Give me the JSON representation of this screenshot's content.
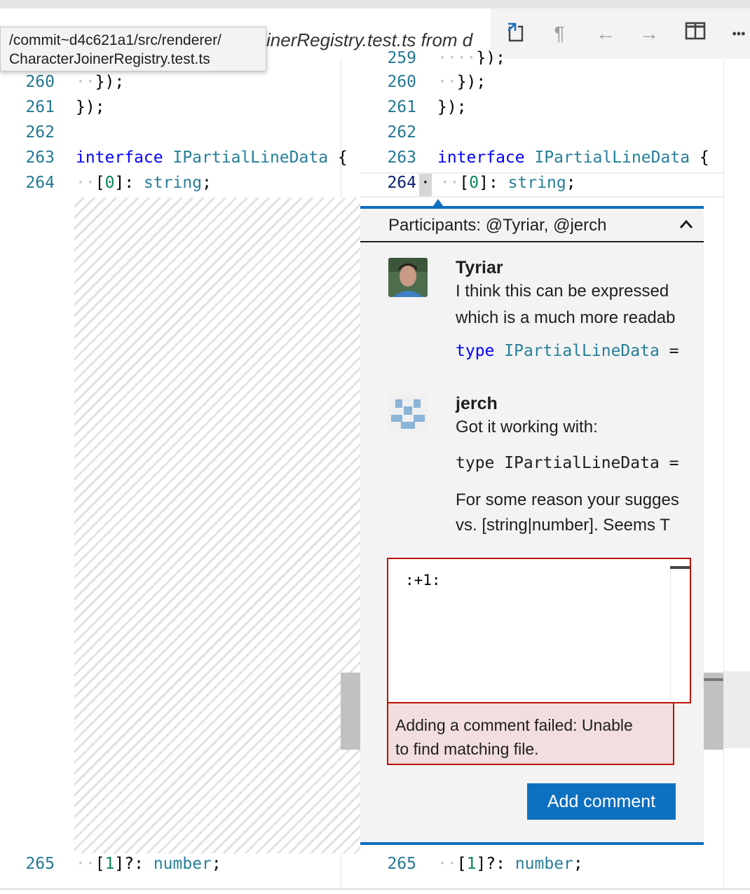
{
  "tab": {
    "title": "inerRegistry.test.ts from d",
    "actions": [
      {
        "name": "open-file-icon",
        "glyph": "⎘"
      },
      {
        "name": "whitespace-icon",
        "glyph": "¶"
      },
      {
        "name": "previous-change-icon",
        "glyph": "←"
      },
      {
        "name": "next-change-icon",
        "glyph": "→"
      },
      {
        "name": "split-editor-icon",
        "glyph": "◫"
      },
      {
        "name": "more-actions-icon",
        "glyph": "•••"
      }
    ]
  },
  "tooltip": {
    "line1": "/commit~d4c621a1/src/renderer/",
    "line2": "CharacterJoinerRegistry.test.ts"
  },
  "left_editor": {
    "lines": [
      {
        "num": "260",
        "text": "});"
      },
      {
        "num": "261",
        "text": "});"
      },
      {
        "num": "262",
        "text": ""
      },
      {
        "num": "263",
        "keyword": "interface",
        "type": "IPartialLineData",
        "rest": " {"
      },
      {
        "num": "264",
        "index": "0",
        "type": "string"
      },
      {
        "num": "265",
        "index": "1",
        "type": "number"
      }
    ]
  },
  "right_editor": {
    "partial_line": "259",
    "lines": [
      {
        "num": "260",
        "text": "});"
      },
      {
        "num": "261",
        "text": "});"
      },
      {
        "num": "262",
        "text": ""
      },
      {
        "num": "263",
        "keyword": "interface",
        "type": "IPartialLineData",
        "rest": " {"
      },
      {
        "num": "264",
        "index": "0",
        "type": "string"
      },
      {
        "num": "265",
        "index": "1",
        "type": "number"
      }
    ]
  },
  "comment_widget": {
    "participants": "Participants: @Tyriar, @jerch",
    "collapse_icon": "^",
    "comments": [
      {
        "author": "Tyriar",
        "body_line1": "I think this can be expressed",
        "body_line2": "which is a much more readab",
        "code_keyword": "type",
        "code_type": "IPartialLineData",
        "code_rest": " ="
      },
      {
        "author": "jerch",
        "body_line1": "Got it working with:",
        "code": "type IPartialLineData =",
        "body_line3": "For some reason your sugges",
        "body_line4": "vs. [string|number]. Seems T"
      }
    ],
    "reply_value": ":+1:",
    "error": "Adding a comment failed: Unable to find matching file.",
    "error_line1": "Adding a comment failed: Unable",
    "error_line2": "to find matching file.",
    "add_button": "Add comment"
  }
}
